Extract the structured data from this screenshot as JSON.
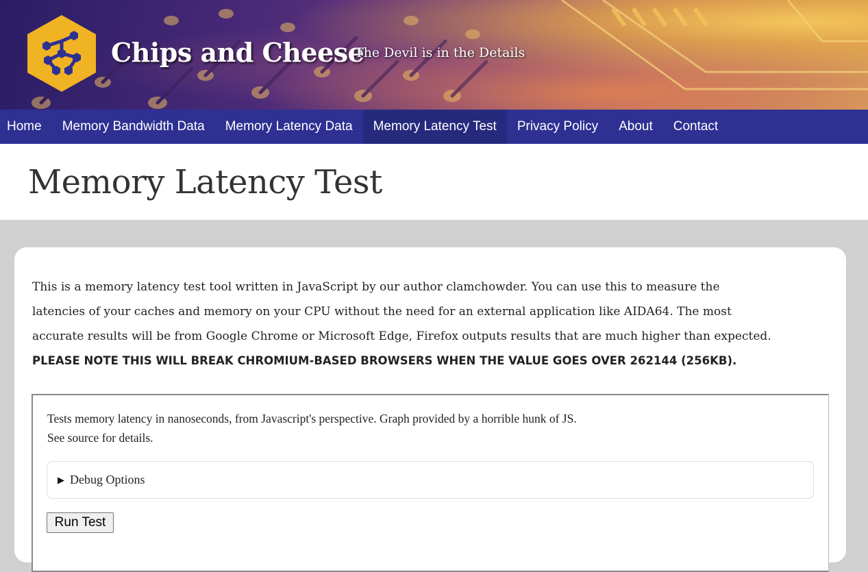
{
  "header": {
    "site_title": "Chips and Cheese",
    "tagline": "The Devil is in the Details",
    "logo_icon": "hexagon-molecule-logo-icon",
    "colors": {
      "logo_hex": "#f0b323",
      "logo_molecule": "#2e3192"
    }
  },
  "nav": {
    "items": [
      {
        "label": "Home"
      },
      {
        "label": "Memory Bandwidth Data"
      },
      {
        "label": "Memory Latency Data"
      },
      {
        "label": "Memory Latency Test"
      },
      {
        "label": "Privacy Policy"
      },
      {
        "label": "About"
      },
      {
        "label": "Contact"
      }
    ],
    "active": "Memory Latency Test",
    "colors": {
      "background": "#2e3192",
      "active_background": "#262a7d"
    }
  },
  "page": {
    "title": "Memory Latency Test"
  },
  "intro": {
    "line1": "This is a memory latency test tool written in JavaScript by our author clamchowder. You can use this to measure the",
    "line2": "latencies of your caches and memory on your CPU without the need for an external application like AIDA64. The most",
    "line3": "accurate results will be from Google Chrome or Microsoft Edge, Firefox outputs results that are much higher than expected.",
    "warning": "PLEASE NOTE THIS WILL BREAK CHROMIUM-BASED BROWSERS WHEN THE VALUE GOES OVER 262144 (256KB)."
  },
  "embed": {
    "desc_line1": "Tests memory latency in nanoseconds, from Javascript's perspective. Graph provided by a horrible hunk of JS.",
    "desc_line2": "See source for details.",
    "details_label": "Debug Options",
    "details_icon": "disclosure-triangle-icon",
    "run_button": "Run Test"
  }
}
